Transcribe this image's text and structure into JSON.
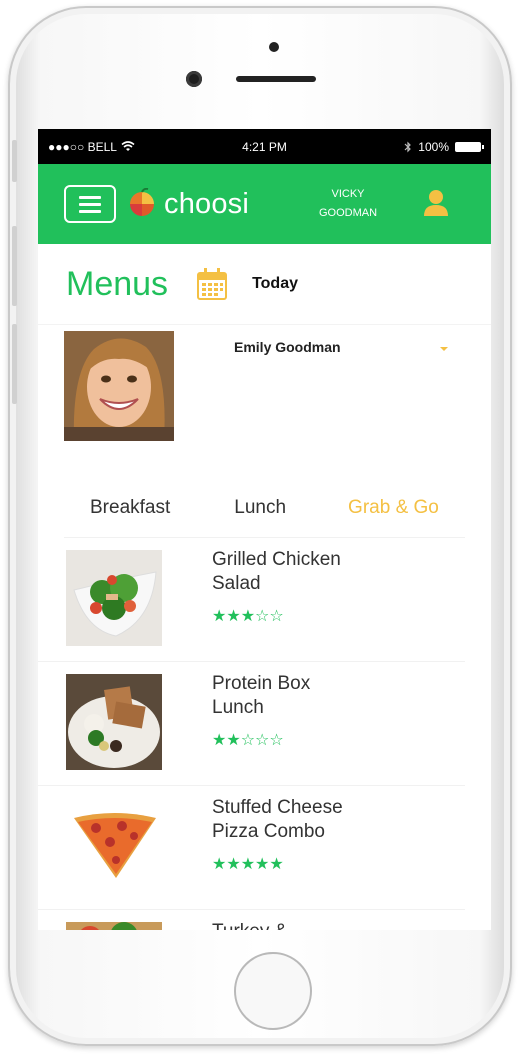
{
  "statusbar": {
    "carrier": "●●●○○ BELL",
    "time": "4:21 PM",
    "battery": "100%"
  },
  "header": {
    "logo_text": "choosi",
    "user_first": "VICKY",
    "user_last": "GOODMAN"
  },
  "page": {
    "title": "Menus",
    "date_label": "Today"
  },
  "child": {
    "name": "Emily Goodman"
  },
  "tabs": [
    {
      "label": "Breakfast",
      "active": false
    },
    {
      "label": "Lunch",
      "active": false
    },
    {
      "label": "Grab & Go",
      "active": true
    }
  ],
  "menu_items": [
    {
      "line1": "Grilled Chicken",
      "line2": "Salad",
      "stars": "★★★☆☆",
      "rating": 3
    },
    {
      "line1": "Protein Box",
      "line2": "Lunch",
      "stars": "★★☆☆☆",
      "rating": 2
    },
    {
      "line1": "Stuffed Cheese",
      "line2": "Pizza Combo",
      "stars": "★★★★★",
      "rating": 5
    },
    {
      "line1": "Turkey &",
      "line2": "",
      "stars": "",
      "rating": null
    }
  ],
  "colors": {
    "brand_green": "#21c05b",
    "accent_yellow": "#f4c043"
  },
  "icons": [
    "menu-icon",
    "choosi-logo-icon",
    "user-icon",
    "calendar-icon",
    "dropdown-caret-icon",
    "star-icon",
    "wifi-icon",
    "bluetooth-icon",
    "battery-icon"
  ]
}
